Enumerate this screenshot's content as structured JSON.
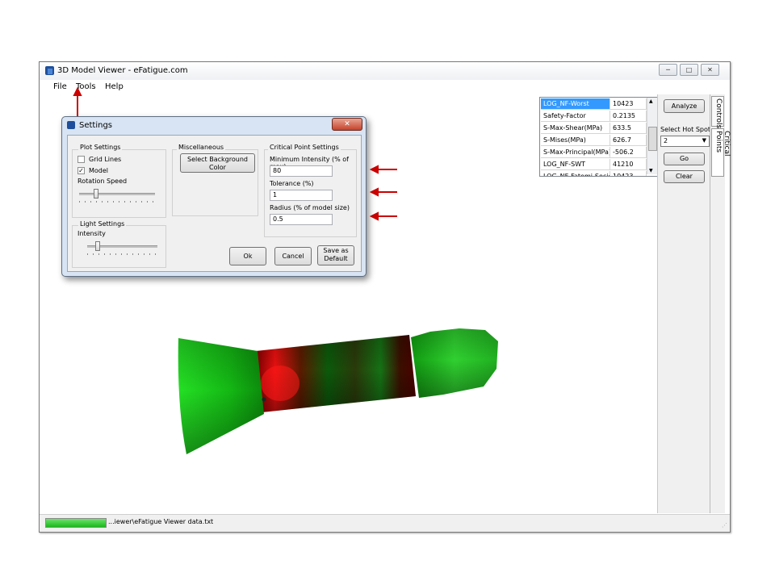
{
  "window": {
    "title": "3D Model Viewer - eFatigue.com",
    "minimize": "─",
    "maximize": "□",
    "close": "✕"
  },
  "menu": [
    "File",
    "Tools",
    "Help"
  ],
  "results_table": {
    "rows": [
      [
        "LOG_NF-Worst",
        "10423"
      ],
      [
        "Safety-Factor",
        "0.2135"
      ],
      [
        "S-Max-Shear(MPa)",
        "633.5"
      ],
      [
        "S-Mises(MPa)",
        "626.7"
      ],
      [
        "S-Max-Principal(MPa)",
        "-506.2"
      ],
      [
        "LOG_NF-SWT",
        "41210"
      ],
      [
        "LOG_NF-Fatemi-Socie",
        "10423"
      ]
    ],
    "selected_row": 0
  },
  "controls": {
    "analyze": "Analyze",
    "hot_spot_label": "Select Hot Spot",
    "hot_spot_value": "2",
    "go": "Go",
    "clear": "Clear"
  },
  "side_tabs": [
    "Controls",
    "Critical Points"
  ],
  "status": {
    "file": "...iewer\\eFatigue Viewer data.txt",
    "progress": 1.0
  },
  "settings": {
    "title": "Settings",
    "plot_settings": {
      "label": "Plot Settings",
      "grid_lines": "Grid Lines",
      "grid_checked": false,
      "model": "Model",
      "model_checked": true,
      "rotation_speed": "Rotation Speed",
      "rotation_value": 0.2
    },
    "misc": {
      "label": "Miscellaneous",
      "bg_button": "Select Background Color"
    },
    "critical": {
      "label": "Critical Point Settings",
      "min_intensity_label": "Minimum Intensity (% of max)",
      "min_intensity": "80",
      "tolerance_label": "Tolerance (%)",
      "tolerance": "1",
      "radius_label": "Radius (% of model size)",
      "radius": "0.5"
    },
    "light": {
      "label": "Light Settings",
      "intensity": "Intensity",
      "intensity_value": 0.12
    },
    "ok": "Ok",
    "cancel": "Cancel",
    "save_default": "Save as Default"
  },
  "colors": {
    "arrow": "#cc0000",
    "selection": "#3399ff",
    "model_green": "#22dd22",
    "model_red": "#e01010"
  }
}
